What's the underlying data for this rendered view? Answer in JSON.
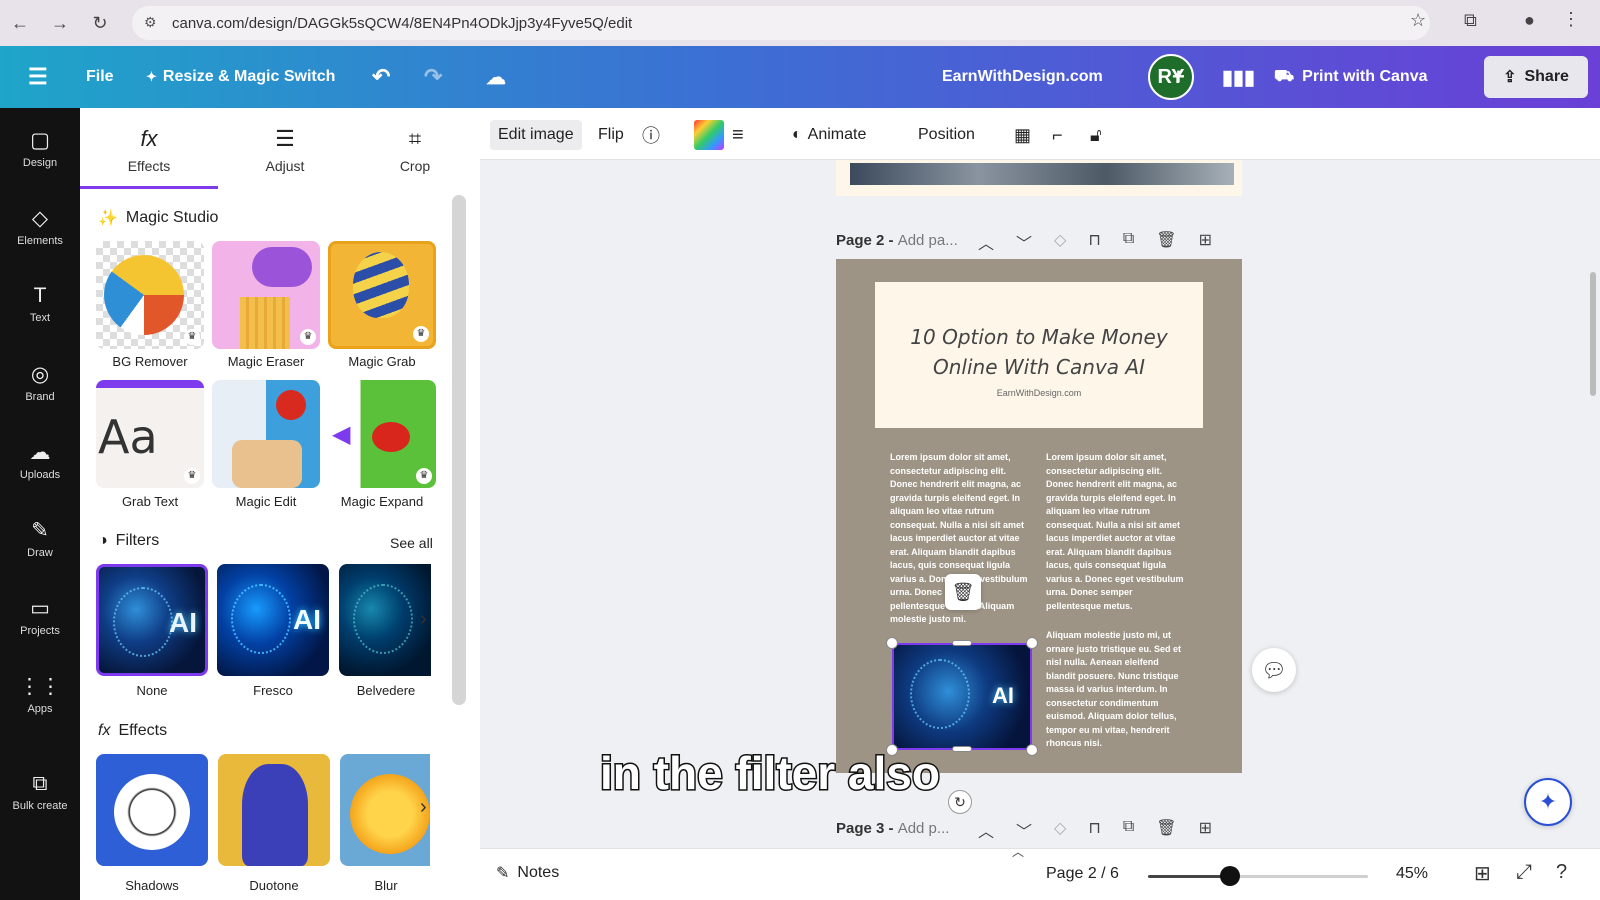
{
  "browser": {
    "url": "canva.com/design/DAGGk5sQCW4/8EN4Pn4ODkJjp3y4Fyve5Q/edit"
  },
  "topbar": {
    "file": "File",
    "resize": "Resize & Magic Switch",
    "site": "EarnWithDesign.com",
    "avatar": "RY",
    "print": "Print with Canva",
    "share": "Share"
  },
  "rail": [
    {
      "label": "Design",
      "icon": "▢"
    },
    {
      "label": "Elements",
      "icon": "◇"
    },
    {
      "label": "Text",
      "icon": "T"
    },
    {
      "label": "Brand",
      "icon": "◎"
    },
    {
      "label": "Uploads",
      "icon": "☁"
    },
    {
      "label": "Draw",
      "icon": "✎"
    },
    {
      "label": "Projects",
      "icon": "▭"
    },
    {
      "label": "Apps",
      "icon": "⋮⋮"
    },
    {
      "label": "Bulk create",
      "icon": "⧉"
    }
  ],
  "panel": {
    "tabs": [
      {
        "label": "Effects"
      },
      {
        "label": "Adjust"
      },
      {
        "label": "Crop"
      }
    ],
    "magic_title": "Magic Studio",
    "magic": [
      "BG Remover",
      "Magic Eraser",
      "Magic Grab",
      "Grab Text",
      "Magic Edit",
      "Magic Expand"
    ],
    "filters_title": "Filters",
    "see_all": "See all",
    "filters": [
      "None",
      "Fresco",
      "Belvedere"
    ],
    "filter_ai": "AI",
    "effects_title": "Effects",
    "effects": [
      "Shadows",
      "Duotone",
      "Blur"
    ]
  },
  "toolbar": {
    "edit_image": "Edit image",
    "flip": "Flip",
    "animate": "Animate",
    "position": "Position"
  },
  "pages": {
    "page2": "Page 2 - ",
    "page2_add": "Add pa...",
    "page3": "Page 3 - ",
    "page3_add": "Add p..."
  },
  "doc": {
    "title_line1": "10 Option to Make Money",
    "title_line2": "Online With Canva AI",
    "subtitle": "EarnWithDesign.com",
    "col1": "Lorem ipsum dolor sit amet, consectetur adipiscing elit. Donec hendrerit elit magna, ac gravida turpis eleifend eget. In aliquam leo vitae rutrum consequat. Nulla a nisi sit amet lacus imperdiet auctor at vitae erat. Aliquam blandit dapibus lacus, quis consequat ligula varius a. Donec eget vestibulum urna. Donec semper pellentesque metus. Aliquam molestie justo mi.",
    "col2": "Lorem ipsum dolor sit amet, consectetur adipiscing elit. Donec hendrerit elit magna, ac gravida turpis eleifend eget. In aliquam leo vitae rutrum consequat. Nulla a nisi sit amet lacus imperdiet auctor at vitae erat. Aliquam blandit dapibus lacus, quis consequat ligula varius a. Donec eget vestibulum urna. Donec semper pellentesque metus.",
    "col3": "Aliquam molestie justo mi, ut ornare justo tristique eu. Sed et nisl nulla. Aenean eleifend blandit posuere. Nunc tristique massa id varius interdum. In consectetur condimentum euismod. Aliquam dolor tellus, tempor eu mi vitae, hendrerit rhoncus nisi.",
    "image_ai": "AI"
  },
  "caption": "in the filter also",
  "bottom": {
    "notes": "Notes",
    "page_count": "Page 2 / 6",
    "zoom": "45%",
    "zoom_level": 0.45
  }
}
